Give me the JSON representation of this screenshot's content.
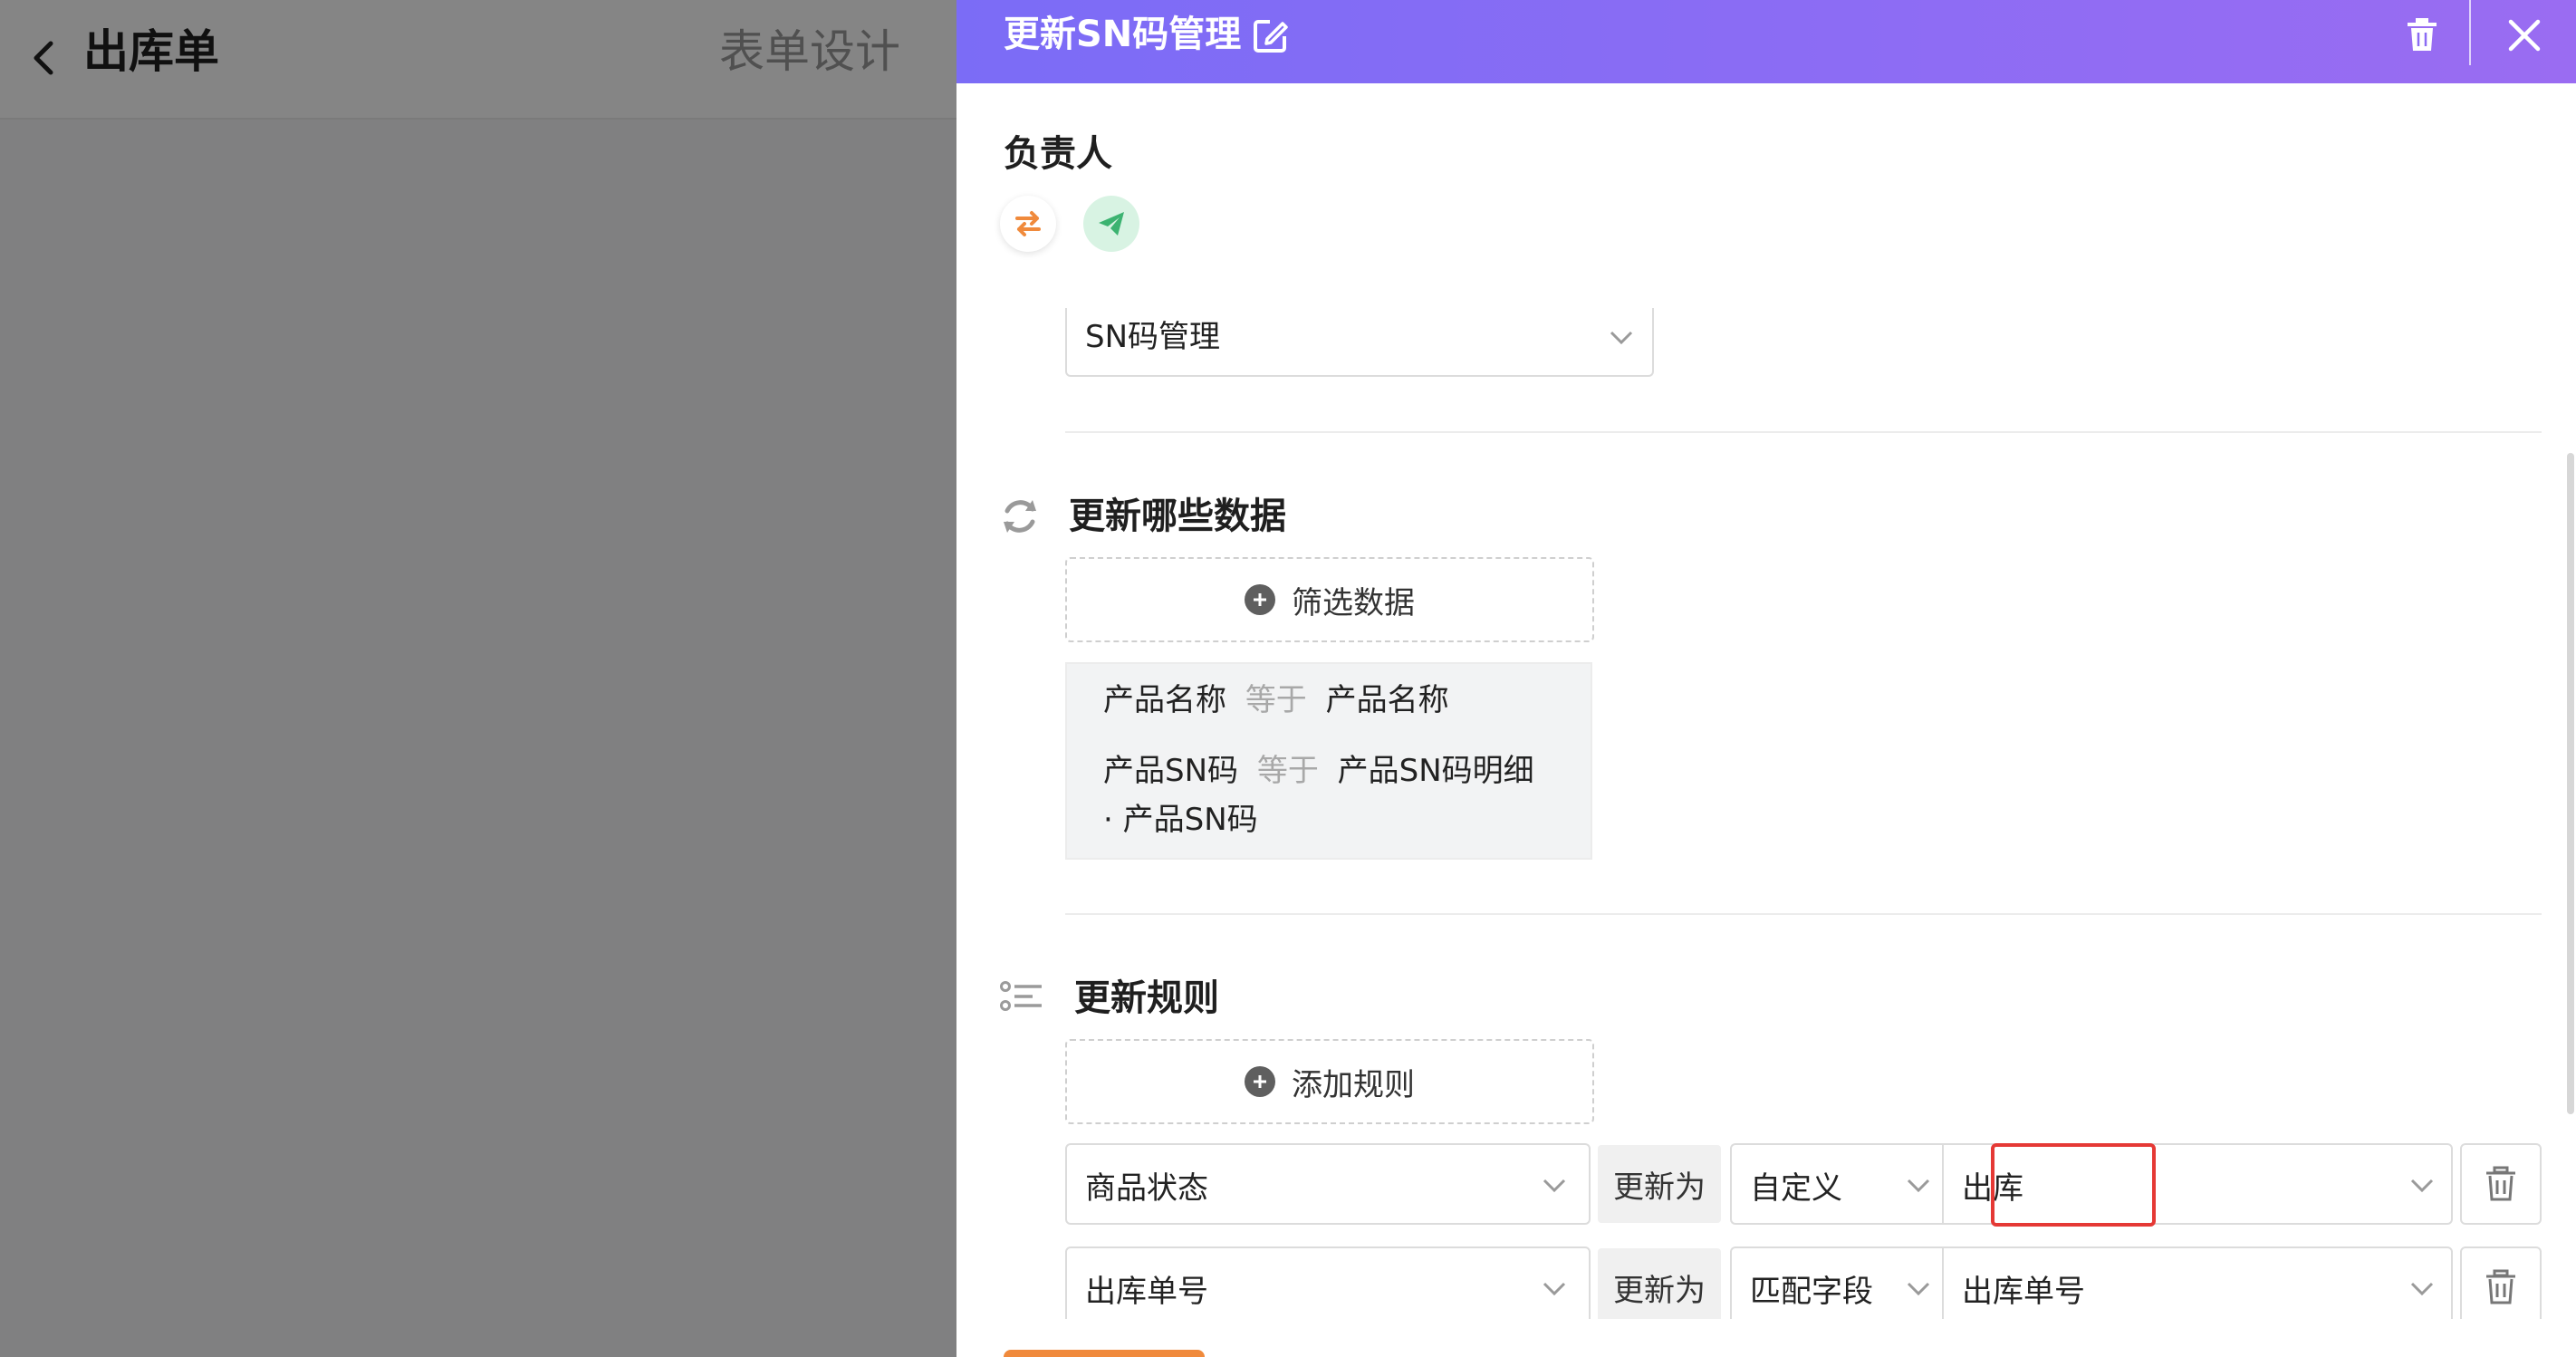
{
  "app": {
    "title": "出库单",
    "tab_form_design": "表单设计"
  },
  "drawer": {
    "title": "更新SN码管理",
    "assignee_label": "负责人",
    "target_form_value": "SN码管理",
    "section_update_data": {
      "title": "更新哪些数据",
      "filter_button": "筛选数据",
      "conditions": [
        {
          "field": "产品名称",
          "operator": "等于",
          "value": "产品名称",
          "value_cont": ""
        },
        {
          "field": "产品SN码",
          "operator": "等于",
          "value": "产品SN码明细",
          "value_cont": "· 产品SN码"
        }
      ]
    },
    "section_rules": {
      "title": "更新规则",
      "add_button": "添加规则",
      "rules": [
        {
          "field": "商品状态",
          "update_to": "更新为",
          "mode": "自定义",
          "value": "出库"
        },
        {
          "field": "出库单号",
          "update_to": "更新为",
          "mode": "匹配字段",
          "value": "出库单号"
        }
      ]
    }
  },
  "colors": {
    "header_start": "#7b6cf6",
    "header_end": "#9a6cf2",
    "highlight": "#e53935",
    "accent_orange": "#f08a3c",
    "send_green": "#3cb371"
  },
  "icons": [
    "back-arrow-icon",
    "edit-icon",
    "trash-icon",
    "close-icon",
    "swap-icon",
    "send-icon",
    "refresh-icon",
    "list-icon",
    "plus-circle-icon",
    "chevron-down-icon"
  ]
}
